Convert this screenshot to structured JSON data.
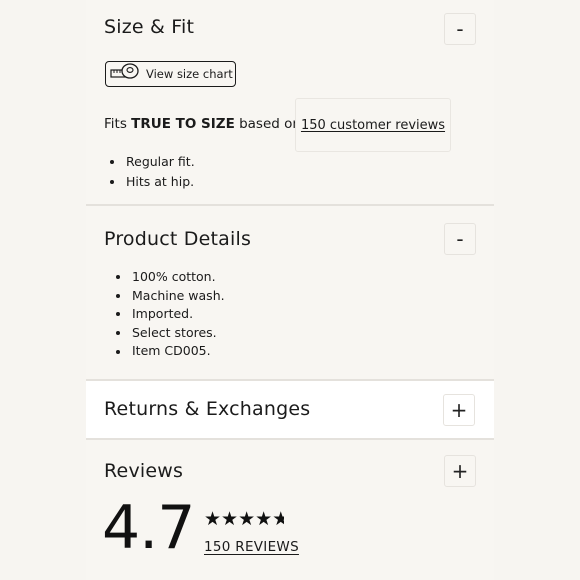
{
  "size_fit": {
    "title": "Size & Fit",
    "toggle": "-",
    "size_chart_label": "View size chart",
    "fits_prefix": "Fits ",
    "fits_emphasis": "TRUE TO SIZE",
    "fits_suffix": " based on",
    "reviews_link": "150 customer reviews",
    "bullets": [
      "Regular fit.",
      "Hits at hip."
    ]
  },
  "product_details": {
    "title": "Product Details",
    "toggle": "-",
    "bullets": [
      "100% cotton.",
      "Machine wash.",
      "Imported.",
      "Select stores.",
      "Item CD005."
    ]
  },
  "returns": {
    "title": "Returns & Exchanges",
    "toggle": "+"
  },
  "reviews": {
    "title": "Reviews",
    "toggle": "+",
    "rating": "4.7",
    "stars": "★★★★★",
    "stars_value": 4.7,
    "count_link": "150 REVIEWS"
  },
  "icons": {
    "size_chart": "measuring-tape-icon",
    "star": "star-icon"
  }
}
